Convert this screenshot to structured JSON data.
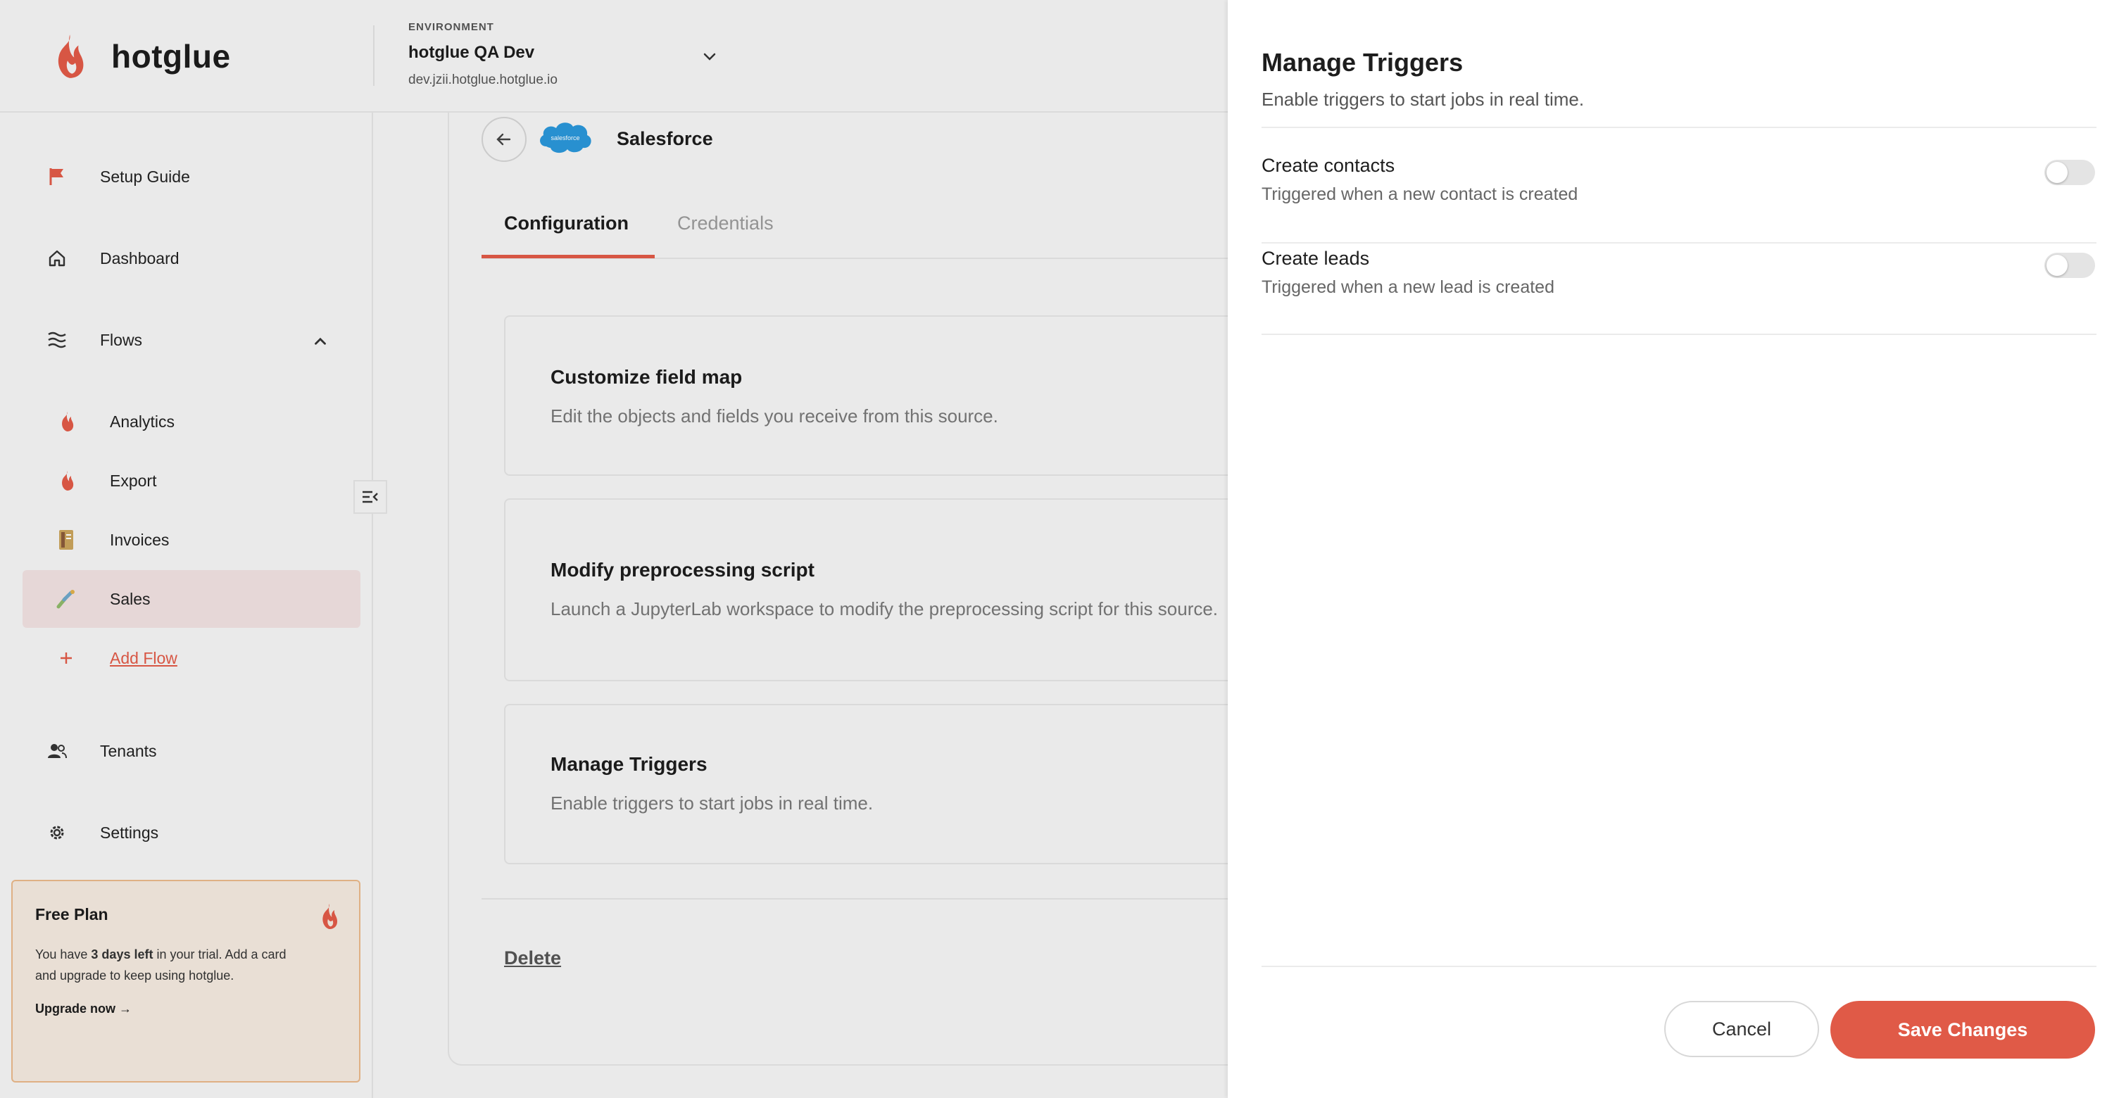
{
  "brand": {
    "name": "hotglue"
  },
  "environment": {
    "label": "ENVIRONMENT",
    "name": "hotglue QA Dev",
    "url": "dev.jzii.hotglue.hotglue.io"
  },
  "sidebar": {
    "items": [
      {
        "label": "Setup Guide",
        "icon": "flag-icon"
      },
      {
        "label": "Dashboard",
        "icon": "home-icon"
      },
      {
        "label": "Flows",
        "icon": "flows-icon"
      },
      {
        "label": "Tenants",
        "icon": "users-icon"
      },
      {
        "label": "Settings",
        "icon": "gear-icon"
      }
    ],
    "flows": [
      {
        "label": "Analytics",
        "icon": "flame-icon"
      },
      {
        "label": "Export",
        "icon": "flame-icon"
      },
      {
        "label": "Invoices",
        "icon": "invoice-icon"
      },
      {
        "label": "Sales",
        "icon": "sales-icon",
        "active": true
      }
    ],
    "add_flow": "Add Flow",
    "plan": {
      "title": "Free Plan",
      "text_before": "You have ",
      "days": "3 days left",
      "text_after": " in your trial. Add a card and upgrade to keep using hotglue.",
      "upgrade": "Upgrade now",
      "upgrade_arrow": "→"
    }
  },
  "main": {
    "connector": "Salesforce",
    "connector_logo_text": "salesforce",
    "tabs": [
      "Configuration",
      "Credentials"
    ],
    "cards": [
      {
        "title": "Customize field map",
        "desc": "Edit the objects and fields you receive from this source."
      },
      {
        "title": "Modify preprocessing script",
        "desc": "Launch a JupyterLab workspace to modify the preprocessing script for this source."
      },
      {
        "title": "Manage Triggers",
        "desc": "Enable triggers to start jobs in real time."
      }
    ],
    "delete": "Delete"
  },
  "drawer": {
    "title": "Manage Triggers",
    "subtitle": "Enable triggers to start jobs in real time.",
    "triggers": [
      {
        "title": "Create contacts",
        "desc": "Triggered when a new contact is created",
        "enabled": false
      },
      {
        "title": "Create leads",
        "desc": "Triggered when a new lead is created",
        "enabled": false
      }
    ],
    "cancel": "Cancel",
    "save": "Save Changes"
  },
  "colors": {
    "accent": "#e05a47",
    "active_bg": "#f0e0e0",
    "plan_bg": "#f3e9de",
    "plan_border": "#e9b88a"
  }
}
